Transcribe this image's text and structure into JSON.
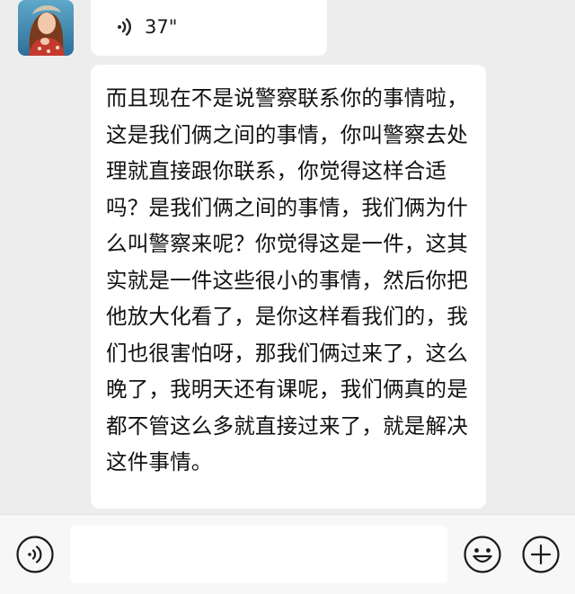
{
  "voice_message": {
    "duration": "37\""
  },
  "text_message": {
    "content": "而且现在不是说警察联系你的事情啦，这是我们俩之间的事情，你叫警察去处理就直接跟你联系，你觉得这样合适吗？是我们俩之间的事情，我们俩为什么叫警察来呢？你觉得这是一件，这其实就是一件这些很小的事情，然后你把他放大化看了，是你这样看我们的，我们也很害怕呀，那我们俩过来了，这么晚了，我明天还有课呢，我们俩真的是都不管这么多就直接过来了，就是解决这件事情。"
  },
  "input_bar": {
    "text_value": "",
    "voice_icon": "voice-input-icon",
    "emoji_icon": "emoji-icon",
    "plus_icon": "plus-icon"
  },
  "colors": {
    "chat_background": "#ededed",
    "bubble_background": "#ffffff",
    "toolbar_background": "#f7f7f7",
    "text": "#111111"
  }
}
